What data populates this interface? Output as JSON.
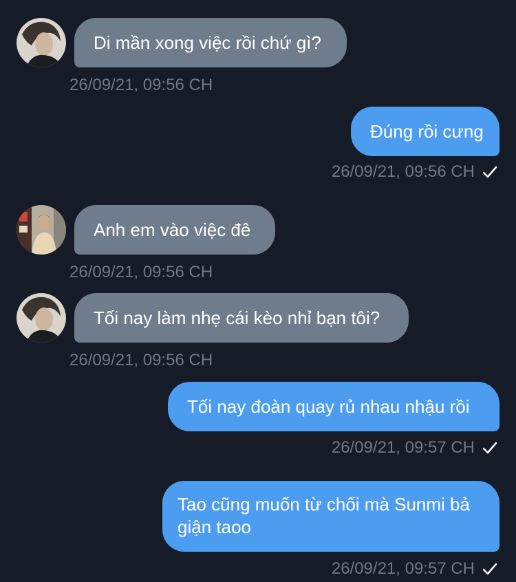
{
  "messages": [
    {
      "text": "Di mần xong việc rồi chứ gì?",
      "timestamp": "26/09/21, 09:56 CH",
      "direction": "incoming",
      "avatar": "avatar-1"
    },
    {
      "text": "Đúng rồi cưng",
      "timestamp": "26/09/21, 09:56 CH",
      "direction": "outgoing",
      "status": "check-icon"
    },
    {
      "text": "Anh em vào việc đê",
      "timestamp": "26/09/21, 09:56 CH",
      "direction": "incoming",
      "avatar": "avatar-2"
    },
    {
      "text": "Tối nay làm nhẹ cái kèo nhỉ bạn tôi?",
      "timestamp": "26/09/21, 09:56 CH",
      "direction": "incoming",
      "avatar": "avatar-1"
    },
    {
      "text": "Tối nay đoàn quay rủ nhau nhậu rồi",
      "timestamp": "26/09/21, 09:57 CH",
      "direction": "outgoing",
      "status": "check-icon"
    },
    {
      "text": "Tao cũng muốn từ chối mà Sunmi bả giận taoo",
      "timestamp": "26/09/21, 09:57 CH",
      "direction": "outgoing",
      "status": "check-icon"
    }
  ],
  "colors": {
    "background": "#151c27",
    "incoming_bubble": "#6f7c8c",
    "outgoing_bubble": "#4c9cf0",
    "timestamp": "#6e7886"
  }
}
